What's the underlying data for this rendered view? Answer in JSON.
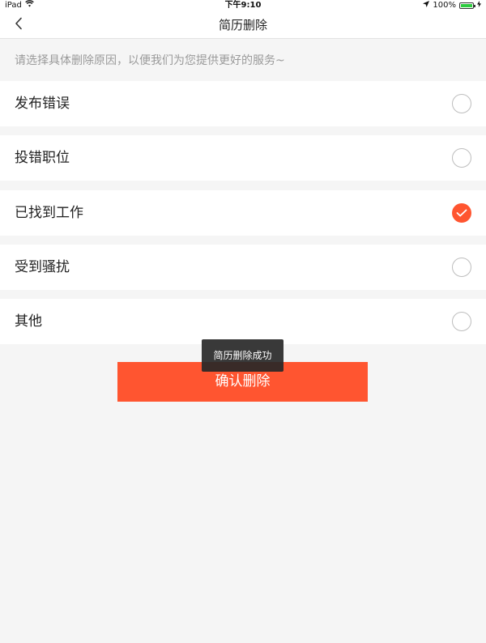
{
  "status_bar": {
    "device": "iPad",
    "time": "下午9:10",
    "battery_text": "100%",
    "battery_level": 1.0
  },
  "nav": {
    "title": "简历删除"
  },
  "hint": "请选择具体删除原因，以便我们为您提供更好的服务~",
  "options": [
    {
      "label": "发布错误",
      "checked": false
    },
    {
      "label": "投错职位",
      "checked": false
    },
    {
      "label": "已找到工作",
      "checked": true
    },
    {
      "label": "受到骚扰",
      "checked": false
    },
    {
      "label": "其他",
      "checked": false
    }
  ],
  "confirm_label": "确认删除",
  "toast_text": "简历删除成功",
  "colors": {
    "accent": "#ff5530",
    "background": "#f5f5f5",
    "hint_text": "#9a9a9a"
  }
}
